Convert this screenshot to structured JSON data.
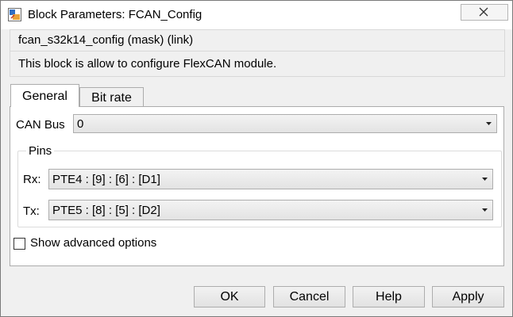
{
  "window": {
    "title": "Block Parameters: FCAN_Config",
    "icon": "block-parameters-icon",
    "close_icon": "close-icon"
  },
  "mask": {
    "title": "fcan_s32k14_config (mask) (link)",
    "description": "This block is allow to configure FlexCAN module."
  },
  "tabs": [
    {
      "label": "General",
      "selected": true
    },
    {
      "label": "Bit rate",
      "selected": false
    }
  ],
  "general": {
    "can_bus": {
      "label": "CAN Bus",
      "value": "0"
    },
    "pins": {
      "label": "Pins",
      "rx": {
        "label": "Rx:",
        "value": "PTE4 : [9] : [6] : [D1]"
      },
      "tx": {
        "label": "Tx:",
        "value": "PTE5 : [8] : [5] : [D2]"
      }
    },
    "advanced": {
      "label": "Show advanced options",
      "checked": false
    }
  },
  "buttons": {
    "ok": "OK",
    "cancel": "Cancel",
    "help": "Help",
    "apply": "Apply"
  }
}
